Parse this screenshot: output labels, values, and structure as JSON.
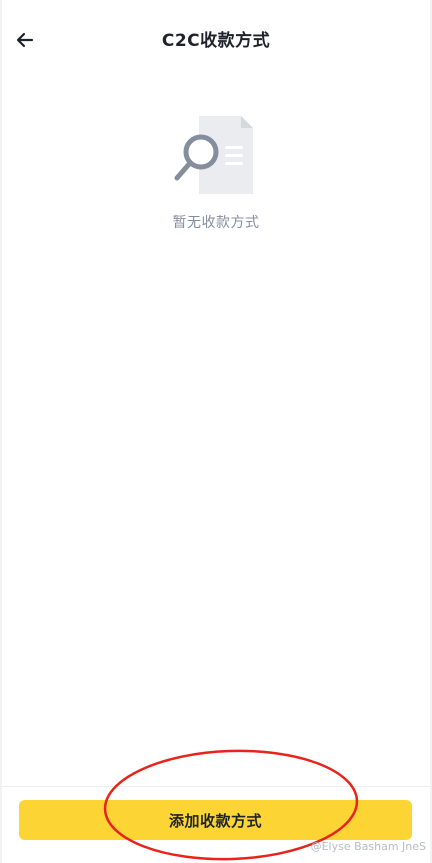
{
  "header": {
    "title": "C2C收款方式",
    "back_icon": "arrow-left-icon"
  },
  "empty_state": {
    "illustration_icon": "document-search-icon",
    "message": "暂无收款方式"
  },
  "footer": {
    "add_button_label": "添加收款方式"
  },
  "annotation": {
    "type": "red-ellipse-highlight",
    "color": "#e8231b"
  },
  "watermark": {
    "text": "@Elyse Basham JneS"
  },
  "colors": {
    "accent": "#fcd535",
    "title_text": "#1e2329",
    "secondary_text": "#848e9c"
  }
}
